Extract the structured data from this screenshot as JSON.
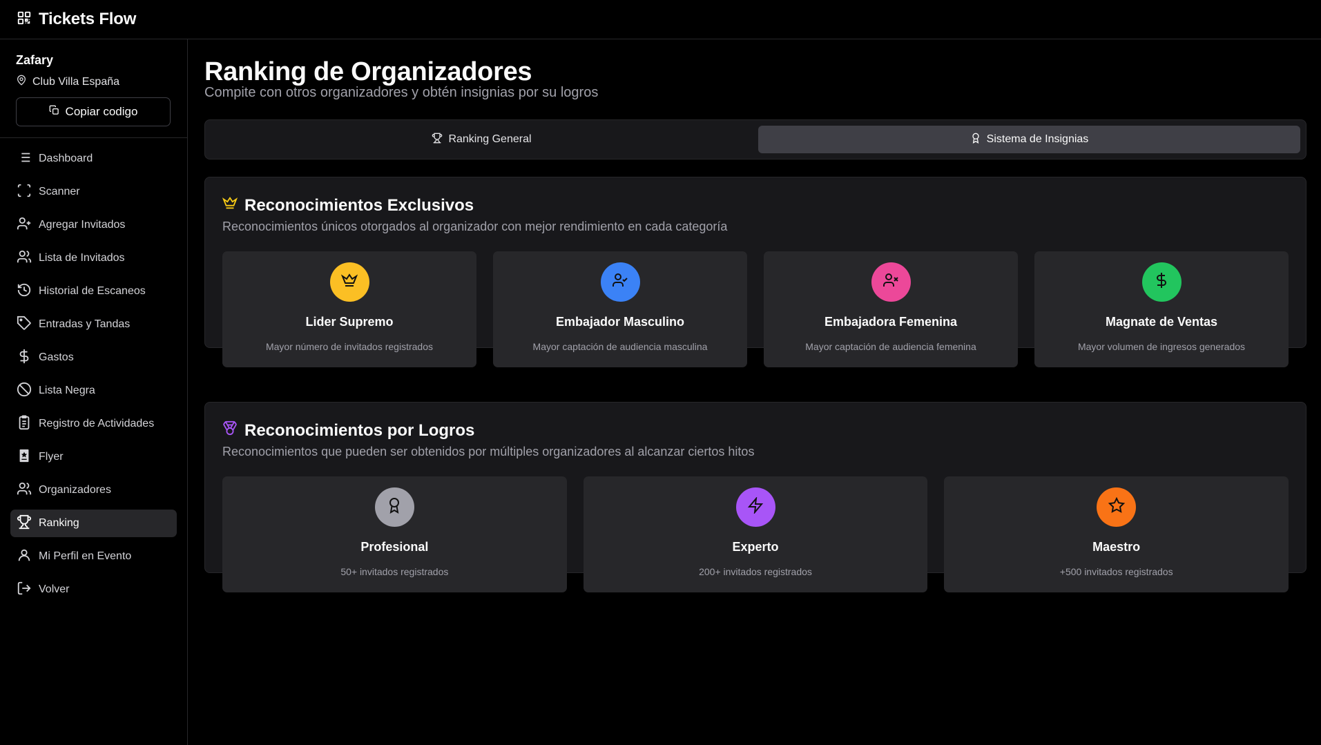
{
  "app": {
    "title": "Tickets Flow"
  },
  "sidebar": {
    "org_name": "Zafary",
    "venue": "Club Villa España",
    "copy_label": "Copiar codigo",
    "items": [
      {
        "label": "Dashboard",
        "icon": "list-icon"
      },
      {
        "label": "Scanner",
        "icon": "scan-icon"
      },
      {
        "label": "Agregar Invitados",
        "icon": "user-plus-icon"
      },
      {
        "label": "Lista de Invitados",
        "icon": "users-icon"
      },
      {
        "label": "Historial de Escaneos",
        "icon": "history-icon"
      },
      {
        "label": "Entradas y Tandas",
        "icon": "tag-icon"
      },
      {
        "label": "Gastos",
        "icon": "dollar-icon"
      },
      {
        "label": "Lista Negra",
        "icon": "ban-icon"
      },
      {
        "label": "Registro de Actividades",
        "icon": "clipboard-icon"
      },
      {
        "label": "Flyer",
        "icon": "flyer-icon"
      },
      {
        "label": "Organizadores",
        "icon": "users-icon"
      },
      {
        "label": "Ranking",
        "icon": "trophy-icon",
        "active": true
      },
      {
        "label": "Mi Perfil en Evento",
        "icon": "user-icon"
      },
      {
        "label": "Volver",
        "icon": "logout-icon"
      }
    ]
  },
  "header": {
    "title": "Ranking de Organizadores",
    "subtitle": "Compite con otros organizadores y obtén insignias por su logros"
  },
  "tabs": [
    {
      "label": "Ranking General",
      "icon": "trophy-icon"
    },
    {
      "label": "Sistema de Insignias",
      "icon": "award-icon",
      "active": true
    }
  ],
  "exclusive": {
    "title": "Reconocimientos Exclusivos",
    "description": "Reconocimientos únicos otorgados al organizador con mejor rendimiento en cada categoría",
    "title_icon_color": "#facc15",
    "cards": [
      {
        "title": "Lider Supremo",
        "desc": "Mayor número de invitados registrados",
        "icon": "crown-icon",
        "color": "#fbbf24"
      },
      {
        "title": "Embajador Masculino",
        "desc": "Mayor captación de audiencia masculina",
        "icon": "user-check-icon",
        "color": "#3b82f6"
      },
      {
        "title": "Embajadora Femenina",
        "desc": "Mayor captación de audiencia femenina",
        "icon": "user-x-icon",
        "color": "#ec4899"
      },
      {
        "title": "Magnate de Ventas",
        "desc": "Mayor volumen de ingresos generados",
        "icon": "dollar-icon",
        "color": "#22c55e"
      }
    ]
  },
  "achievements": {
    "title": "Reconocimientos por Logros",
    "description": "Reconocimientos que pueden ser obtenidos por múltiples organizadores al alcanzar ciertos hitos",
    "title_icon_color": "#a855f7",
    "cards": [
      {
        "title": "Profesional",
        "desc": "50+ invitados registrados",
        "icon": "award-icon",
        "color": "#a1a1aa"
      },
      {
        "title": "Experto",
        "desc": "200+ invitados registrados",
        "icon": "zap-icon",
        "color": "#a855f7"
      },
      {
        "title": "Maestro",
        "desc": "+500 invitados registrados",
        "icon": "star-icon",
        "color": "#f97316"
      }
    ]
  }
}
